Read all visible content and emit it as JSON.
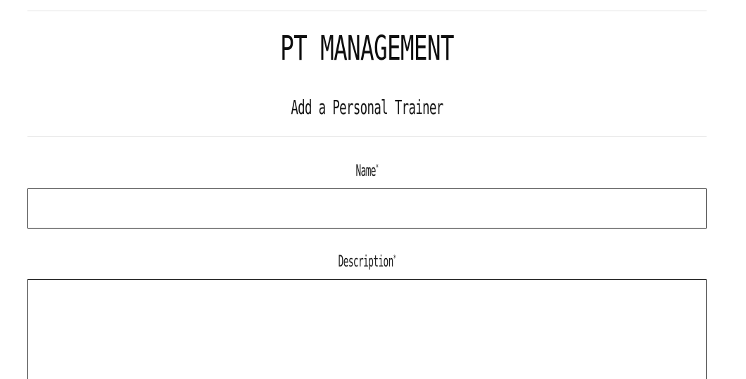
{
  "header": {
    "title": "PT MANAGEMENT",
    "subtitle": "Add a Personal Trainer"
  },
  "form": {
    "name": {
      "label": "Name",
      "required_marker": "*",
      "value": "",
      "placeholder": ""
    },
    "description": {
      "label": "Description",
      "required_marker": "*",
      "value": "",
      "placeholder": ""
    }
  }
}
